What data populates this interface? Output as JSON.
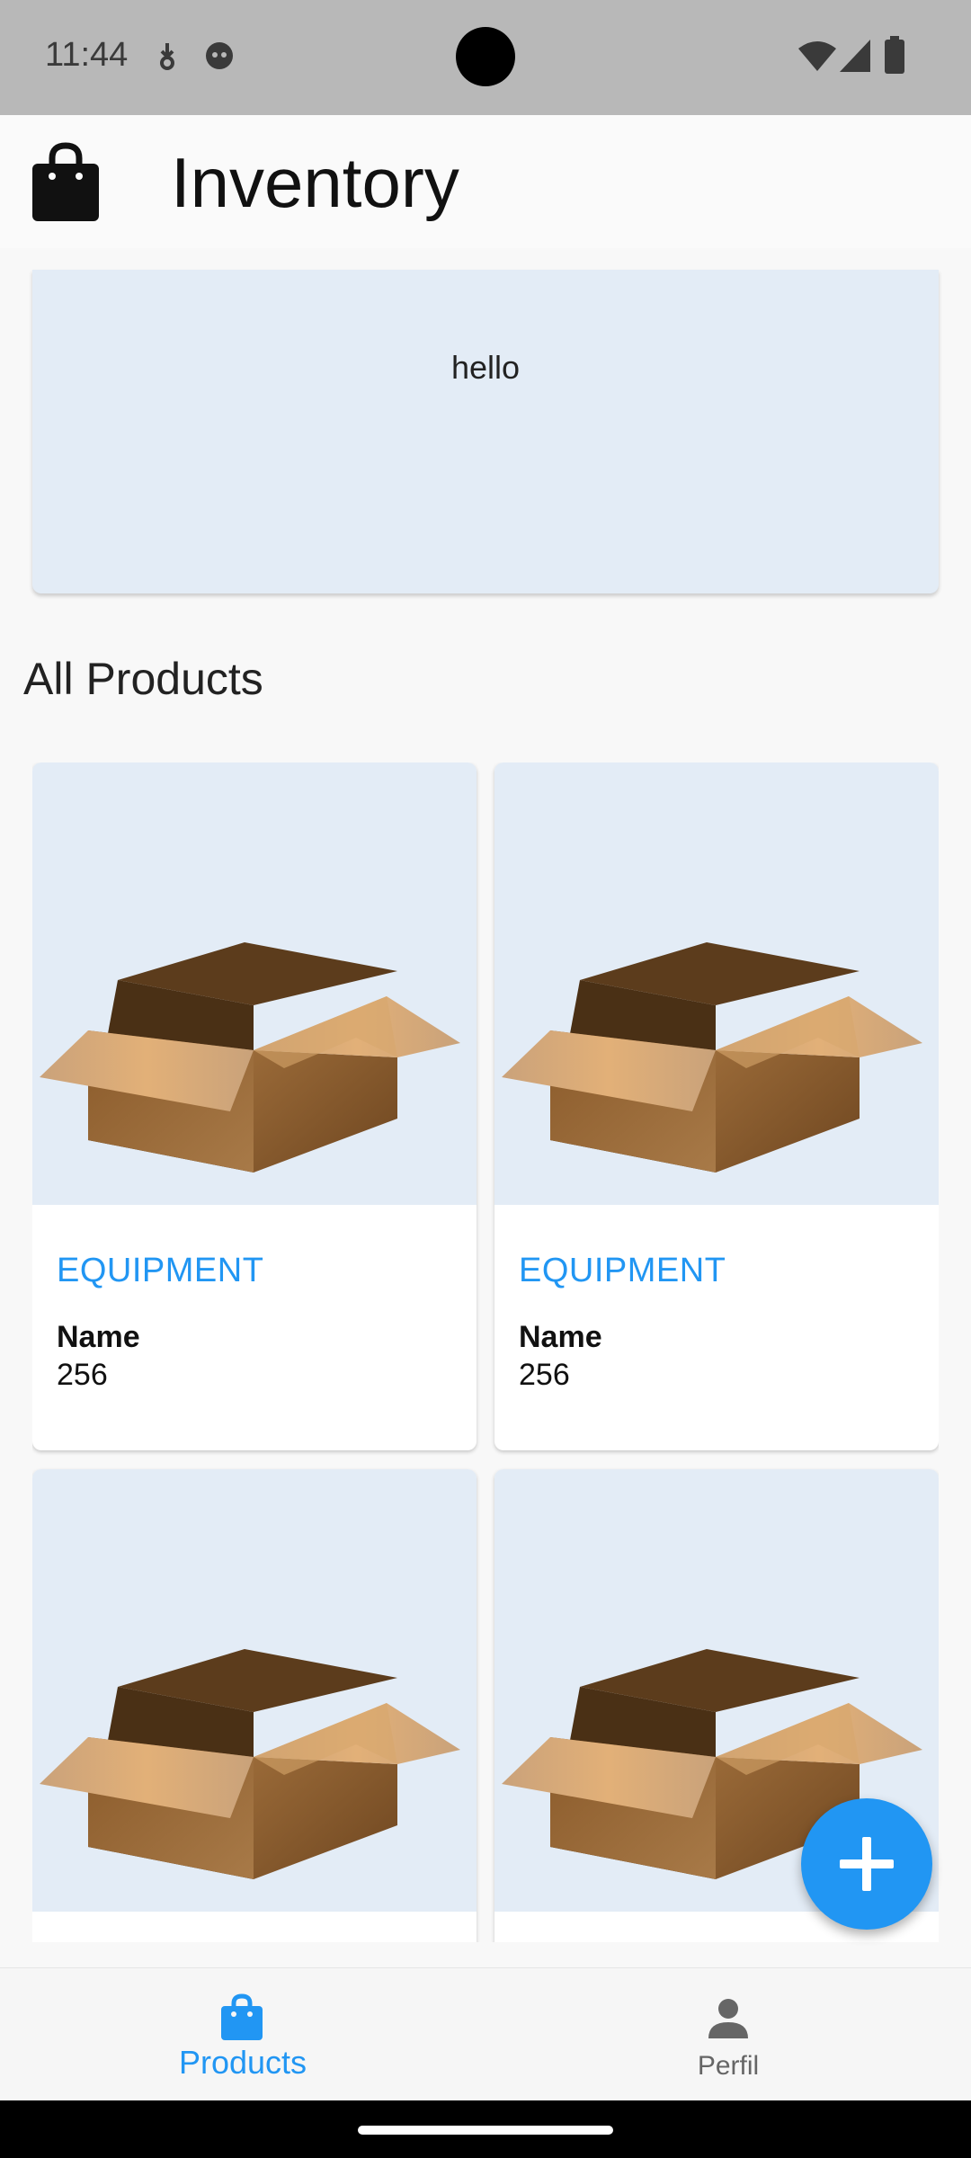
{
  "status_bar": {
    "time": "11:44",
    "icons_left": [
      "download-icon",
      "face-icon"
    ],
    "icons_right": [
      "wifi-icon",
      "signal-icon",
      "battery-icon"
    ]
  },
  "app_bar": {
    "title": "Inventory",
    "logo_icon": "shopping-bag-icon"
  },
  "banner": {
    "text": "hello"
  },
  "section": {
    "title": "All Products"
  },
  "products": [
    {
      "category": "EQUIPMENT",
      "name": "Name",
      "quantity": "256",
      "image_icon": "cardboard-box-icon"
    },
    {
      "category": "EQUIPMENT",
      "name": "Name",
      "quantity": "256",
      "image_icon": "cardboard-box-icon"
    },
    {
      "category": "",
      "name": "",
      "quantity": "",
      "image_icon": "cardboard-box-icon"
    },
    {
      "category": "",
      "name": "",
      "quantity": "",
      "image_icon": "cardboard-box-icon"
    }
  ],
  "fab": {
    "icon": "plus-icon"
  },
  "bottom_nav": {
    "items": [
      {
        "label": "Products",
        "icon": "shopping-bag-icon",
        "active": true
      },
      {
        "label": "Perfil",
        "icon": "person-icon",
        "active": false
      }
    ]
  },
  "colors": {
    "accent": "#2196f3",
    "image_background": "#e3ecf6",
    "status_bar": "#b8b8b8"
  }
}
